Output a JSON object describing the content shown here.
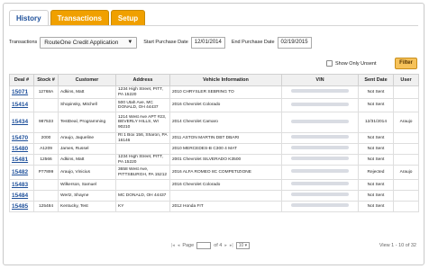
{
  "tabs": [
    {
      "label": "History",
      "active": true
    },
    {
      "label": "Transactions",
      "active": false
    },
    {
      "label": "Setup",
      "active": false
    }
  ],
  "filters": {
    "transactions_label": "Transactions",
    "transactions_value": "RouteOne Credit Application",
    "start_label": "Start Purchase Date",
    "start_value": "12/01/2014",
    "end_label": "End Purchase Date",
    "end_value": "02/19/2015"
  },
  "show_only_unsent": "Show Only Unsent",
  "filter_button": "Filter",
  "columns": [
    "Deal #",
    "Stock #",
    "Customer",
    "Address",
    "Vehicle Information",
    "VIN",
    "Sent Date",
    "User"
  ],
  "rows": [
    {
      "deal": "15071",
      "stock": "12768A",
      "customer": "Adkins, Matt",
      "address": "1234 High Street, PITT, PA 15220",
      "vehicle": "2010 CHRYSLER SEBRING TO",
      "sent": "Not Sent",
      "user": ""
    },
    {
      "deal": "15414",
      "stock": "",
      "customer": "Shopinsky, Mitchell",
      "address": "500 Utah Ave, MC DONALD, OH 44437",
      "vehicle": "2016 Chevrolet Colorado",
      "sent": "Not Sent",
      "user": ""
    },
    {
      "deal": "15434",
      "stock": "987533",
      "customer": "TestDeal, Programming",
      "address": "1214 West Ave APT #23, BEVERLY HILLS, WI 90210",
      "vehicle": "2014 Chevrolet Camaro",
      "sent": "12/31/2014",
      "user": "Araujo"
    },
    {
      "deal": "15470",
      "stock": "2000",
      "customer": "Araujo, Jaqueline",
      "address": "Rt 1 Box 156, Sharon, PA 16146",
      "vehicle": "2011 ASTON MARTIN DBT DBARI",
      "sent": "Not Sent",
      "user": ""
    },
    {
      "deal": "15480",
      "stock": "A1209",
      "customer": "James, Russel",
      "address": "",
      "vehicle": "2010 MERCEDES-B C300 4 MAT",
      "sent": "Not Sent",
      "user": ""
    },
    {
      "deal": "15481",
      "stock": "12566",
      "customer": "Adkins, Matt",
      "address": "1234 High Street, PITT, PA 15220",
      "vehicle": "2001 Chevrolet SILVERADO K3500",
      "sent": "Not Sent",
      "user": ""
    },
    {
      "deal": "15482",
      "stock": "P77899",
      "customer": "Araujo, Vinicius",
      "address": "3658 West Ave, PITTSBURGH, PA 15212",
      "vehicle": "2016 ALFA ROMEO 8C COMPETIZIONE",
      "sent": "Rejected",
      "user": "Araujo"
    },
    {
      "deal": "15483",
      "stock": "",
      "customer": "Wilkerson, Samuel",
      "address": "",
      "vehicle": "2016 Chevrolet Colorado",
      "sent": "Not Sent",
      "user": ""
    },
    {
      "deal": "15484",
      "stock": "",
      "customer": "Wertz, Shayne",
      "address": "MC DONALD, OH 44437",
      "vehicle": "",
      "sent": "Not Sent",
      "user": ""
    },
    {
      "deal": "15485",
      "stock": "125484",
      "customer": "Kentucky, Test",
      "address": "KY",
      "vehicle": "2012 Honda FIT",
      "sent": "Not Sent",
      "user": ""
    }
  ],
  "pager": {
    "page_label": "Page",
    "of_label": "of 4",
    "page_size": "10",
    "view_text": "View 1 - 10 of 32"
  },
  "colors": {
    "tab_orange": "#f0a000",
    "link_blue": "#1d4f9a",
    "filter_button": "#f6c25a"
  }
}
